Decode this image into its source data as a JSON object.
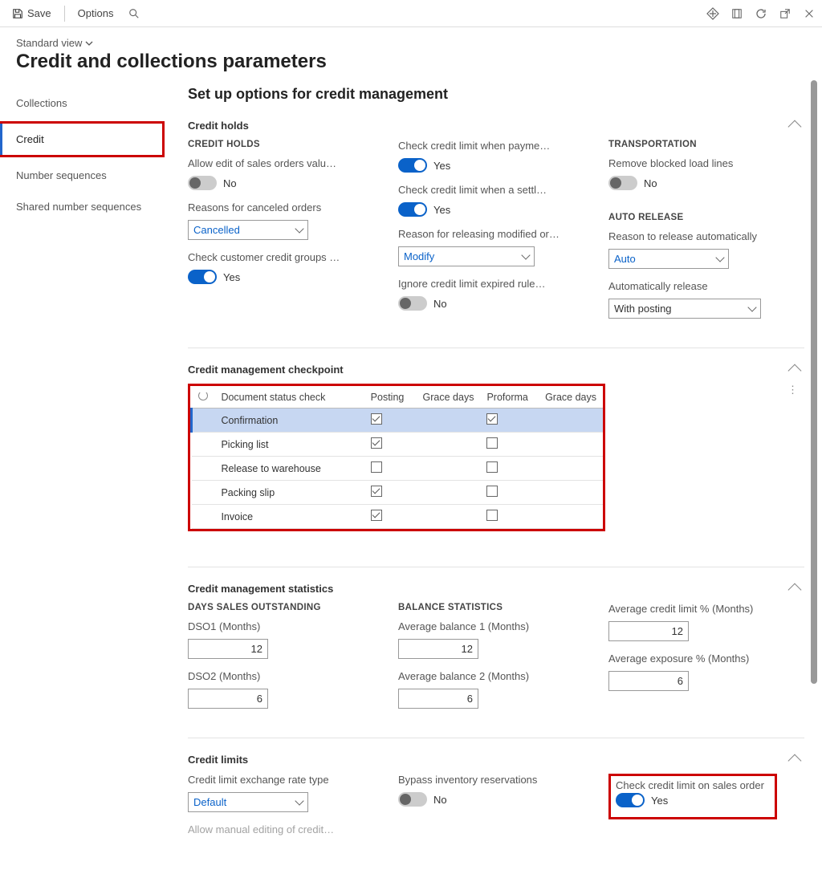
{
  "toolbar": {
    "save_label": "Save",
    "options_label": "Options"
  },
  "header": {
    "view": "Standard view",
    "title": "Credit and collections parameters"
  },
  "nav": {
    "collections": "Collections",
    "credit": "Credit",
    "number_sequences": "Number sequences",
    "shared_number_sequences": "Shared number sequences"
  },
  "main": {
    "section_title": "Set up options for credit management",
    "credit_holds": {
      "title": "Credit holds",
      "sub_credit_holds": "CREDIT HOLDS",
      "allow_edit_label": "Allow edit of sales orders valu…",
      "allow_edit_val": "No",
      "reasons_cancel_label": "Reasons for canceled orders",
      "reasons_cancel_val": "Cancelled",
      "check_groups_label": "Check customer credit groups …",
      "check_groups_val": "Yes",
      "check_payme_label": "Check credit limit when payme…",
      "check_payme_val": "Yes",
      "check_settl_label": "Check credit limit when a settl…",
      "check_settl_val": "Yes",
      "reason_release_label": "Reason for releasing modified or…",
      "reason_release_val": "Modify",
      "ignore_expired_label": "Ignore credit limit expired rule…",
      "ignore_expired_val": "No",
      "sub_transport": "TRANSPORTATION",
      "remove_blocked_label": "Remove blocked load lines",
      "remove_blocked_val": "No",
      "sub_auto": "AUTO RELEASE",
      "reason_auto_label": "Reason to release automatically",
      "reason_auto_val": "Auto",
      "auto_release_label": "Automatically release",
      "auto_release_val": "With posting"
    },
    "checkpoint": {
      "title": "Credit management checkpoint",
      "columns": {
        "doc": "Document status check",
        "posting": "Posting",
        "grace1": "Grace days",
        "proforma": "Proforma",
        "grace2": "Grace days"
      },
      "rows": [
        {
          "doc": "Confirmation",
          "posting": true,
          "proforma": true
        },
        {
          "doc": "Picking list",
          "posting": true,
          "proforma": false
        },
        {
          "doc": "Release to warehouse",
          "posting": false,
          "proforma": false
        },
        {
          "doc": "Packing slip",
          "posting": true,
          "proforma": false
        },
        {
          "doc": "Invoice",
          "posting": true,
          "proforma": false
        }
      ]
    },
    "stats": {
      "title": "Credit management statistics",
      "dso_heading": "DAYS SALES OUTSTANDING",
      "dso1_label": "DSO1 (Months)",
      "dso1_val": "12",
      "dso2_label": "DSO2 (Months)",
      "dso2_val": "6",
      "bal_heading": "BALANCE STATISTICS",
      "avg1_label": "Average balance 1 (Months)",
      "avg1_val": "12",
      "avg2_label": "Average balance 2 (Months)",
      "avg2_val": "6",
      "avglimit_label": "Average credit limit % (Months)",
      "avglimit_val": "12",
      "avgexp_label": "Average exposure % (Months)",
      "avgexp_val": "6"
    },
    "limits": {
      "title": "Credit limits",
      "rate_type_label": "Credit limit exchange rate type",
      "rate_type_val": "Default",
      "allow_manual_label": "Allow manual editing of credit…",
      "bypass_label": "Bypass inventory reservations",
      "bypass_val": "No",
      "check_so_label": "Check credit limit on sales order",
      "check_so_val": "Yes"
    }
  }
}
